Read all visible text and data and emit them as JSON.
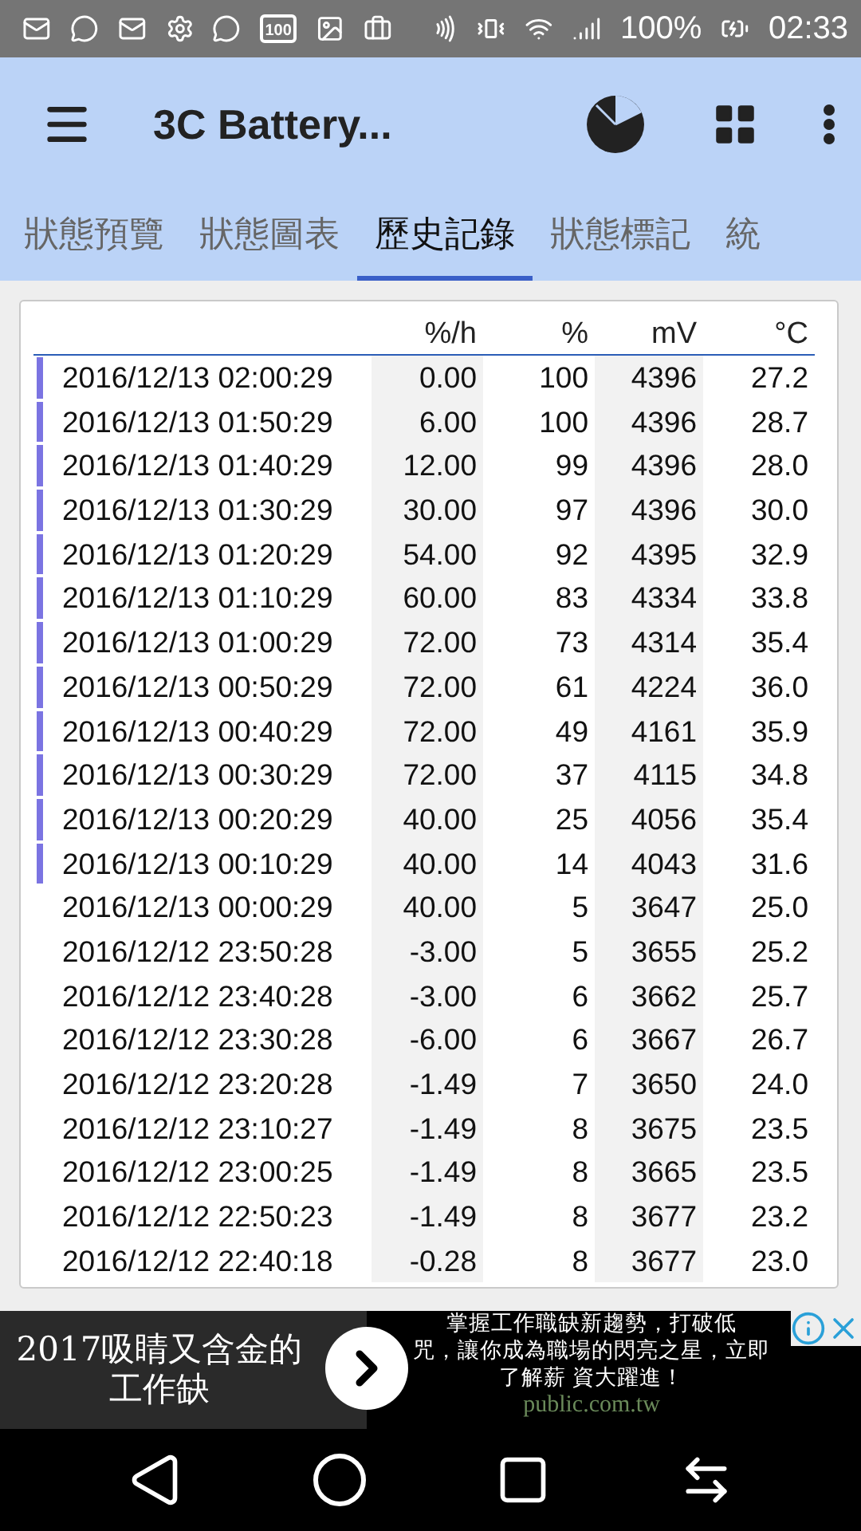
{
  "status_bar": {
    "notification_badge": "100",
    "battery": "100%",
    "time": "02:33"
  },
  "toolbar": {
    "title": "3C Battery..."
  },
  "tabs": [
    {
      "label": "狀態預覽",
      "selected": false
    },
    {
      "label": "狀態圖表",
      "selected": false
    },
    {
      "label": "歷史記錄",
      "selected": true
    },
    {
      "label": "狀態標記",
      "selected": false
    },
    {
      "label": "統",
      "selected": false
    }
  ],
  "table": {
    "columns": [
      "%/h",
      "%",
      "mV",
      "°C"
    ],
    "rows": [
      {
        "time": "2016/12/13 02:00:29",
        "rate": "0.00",
        "percent": "100",
        "mv": "4396",
        "temp": "27.2",
        "charging": true
      },
      {
        "time": "2016/12/13 01:50:29",
        "rate": "6.00",
        "percent": "100",
        "mv": "4396",
        "temp": "28.7",
        "charging": true
      },
      {
        "time": "2016/12/13 01:40:29",
        "rate": "12.00",
        "percent": "99",
        "mv": "4396",
        "temp": "28.0",
        "charging": true
      },
      {
        "time": "2016/12/13 01:30:29",
        "rate": "30.00",
        "percent": "97",
        "mv": "4396",
        "temp": "30.0",
        "charging": true
      },
      {
        "time": "2016/12/13 01:20:29",
        "rate": "54.00",
        "percent": "92",
        "mv": "4395",
        "temp": "32.9",
        "charging": true
      },
      {
        "time": "2016/12/13 01:10:29",
        "rate": "60.00",
        "percent": "83",
        "mv": "4334",
        "temp": "33.8",
        "charging": true
      },
      {
        "time": "2016/12/13 01:00:29",
        "rate": "72.00",
        "percent": "73",
        "mv": "4314",
        "temp": "35.4",
        "charging": true
      },
      {
        "time": "2016/12/13 00:50:29",
        "rate": "72.00",
        "percent": "61",
        "mv": "4224",
        "temp": "36.0",
        "charging": true
      },
      {
        "time": "2016/12/13 00:40:29",
        "rate": "72.00",
        "percent": "49",
        "mv": "4161",
        "temp": "35.9",
        "charging": true
      },
      {
        "time": "2016/12/13 00:30:29",
        "rate": "72.00",
        "percent": "37",
        "mv": "4115",
        "temp": "34.8",
        "charging": true
      },
      {
        "time": "2016/12/13 00:20:29",
        "rate": "40.00",
        "percent": "25",
        "mv": "4056",
        "temp": "35.4",
        "charging": true
      },
      {
        "time": "2016/12/13 00:10:29",
        "rate": "40.00",
        "percent": "14",
        "mv": "4043",
        "temp": "31.6",
        "charging": true
      },
      {
        "time": "2016/12/13 00:00:29",
        "rate": "40.00",
        "percent": "5",
        "mv": "3647",
        "temp": "25.0",
        "charging": false
      },
      {
        "time": "2016/12/12 23:50:28",
        "rate": "-3.00",
        "percent": "5",
        "mv": "3655",
        "temp": "25.2",
        "charging": false
      },
      {
        "time": "2016/12/12 23:40:28",
        "rate": "-3.00",
        "percent": "6",
        "mv": "3662",
        "temp": "25.7",
        "charging": false
      },
      {
        "time": "2016/12/12 23:30:28",
        "rate": "-6.00",
        "percent": "6",
        "mv": "3667",
        "temp": "26.7",
        "charging": false
      },
      {
        "time": "2016/12/12 23:20:28",
        "rate": "-1.49",
        "percent": "7",
        "mv": "3650",
        "temp": "24.0",
        "charging": false
      },
      {
        "time": "2016/12/12 23:10:27",
        "rate": "-1.49",
        "percent": "8",
        "mv": "3675",
        "temp": "23.5",
        "charging": false
      },
      {
        "time": "2016/12/12 23:00:25",
        "rate": "-1.49",
        "percent": "8",
        "mv": "3665",
        "temp": "23.5",
        "charging": false
      },
      {
        "time": "2016/12/12 22:50:23",
        "rate": "-1.49",
        "percent": "8",
        "mv": "3677",
        "temp": "23.2",
        "charging": false
      },
      {
        "time": "2016/12/12 22:40:18",
        "rate": "-0.28",
        "percent": "8",
        "mv": "3677",
        "temp": "23.0",
        "charging": false
      }
    ]
  },
  "ad": {
    "headline": "2017吸睛又含金的工作缺",
    "lines": [
      "掌握工作職缺新趨勢，打破低",
      "咒，讓你成為職場的閃亮之星，立即",
      "了解薪 資大躍進！"
    ],
    "domain": "public.com.tw"
  }
}
